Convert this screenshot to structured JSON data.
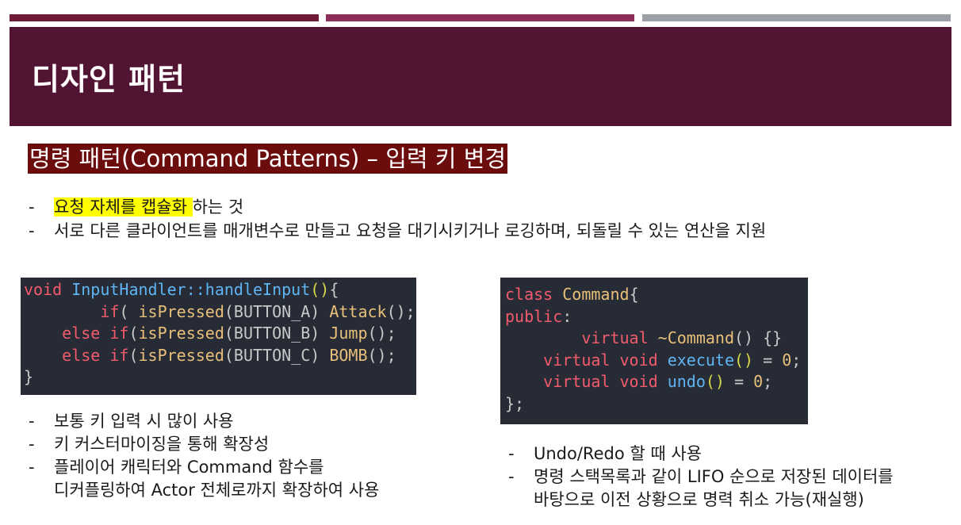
{
  "colors": {
    "topbar": [
      "#6f1a36",
      "#8c2d5a",
      "#9aa0a6"
    ],
    "header_bg": "#521433",
    "subtitle_bg": "#6b0d0d",
    "highlight": "#ffff00",
    "code_bg": "#272b35",
    "code_keyword": "#f35b6d",
    "code_function": "#5fb5f3",
    "code_type": "#e8c07a",
    "code_paren": "#d8d84a",
    "code_text": "#c8c8c8"
  },
  "header": {
    "title": "디자인 패턴"
  },
  "subtitle": "명령 패턴(Command Patterns) – 입력 키 변경",
  "intro_bullets": [
    {
      "dash": "-",
      "highlight": "요청 자체를 캡슐화 ",
      "text": "하는 것"
    },
    {
      "dash": "-",
      "highlight": "",
      "text": "서로 다른 클라이언트를 매개변수로 만들고 요청을 대기시키거나 로깅하며, 되돌릴 수 있는 연산을 지원"
    }
  ],
  "code_left": {
    "icon": "code-snippet",
    "lines": [
      [
        [
          "kw",
          "void"
        ],
        [
          "tx",
          " "
        ],
        [
          "fn",
          "InputHandler::handleInput"
        ],
        [
          "pr",
          "()"
        ],
        [
          "tx",
          "{"
        ]
      ],
      [
        [
          "tx",
          "        "
        ],
        [
          "kw",
          "if"
        ],
        [
          "tx",
          "( "
        ],
        [
          "ty",
          "isPressed"
        ],
        [
          "tx",
          "(BUTTON_A) "
        ],
        [
          "ty",
          "Attack"
        ],
        [
          "tx",
          "();"
        ]
      ],
      [
        [
          "tx",
          "    "
        ],
        [
          "kw",
          "else if"
        ],
        [
          "tx",
          "("
        ],
        [
          "ty",
          "isPressed"
        ],
        [
          "tx",
          "(BUTTON_B) "
        ],
        [
          "ty",
          "Jump"
        ],
        [
          "tx",
          "();"
        ]
      ],
      [
        [
          "tx",
          "    "
        ],
        [
          "kw",
          "else if"
        ],
        [
          "tx",
          "("
        ],
        [
          "ty",
          "isPressed"
        ],
        [
          "tx",
          "(BUTTON_C) "
        ],
        [
          "ty",
          "BOMB"
        ],
        [
          "tx",
          "();"
        ]
      ],
      [
        [
          "tx",
          "}"
        ]
      ]
    ]
  },
  "code_right": {
    "icon": "code-snippet",
    "lines": [
      [
        [
          "kw",
          "class"
        ],
        [
          "tx",
          " "
        ],
        [
          "ty",
          "Command"
        ],
        [
          "tx",
          "{"
        ]
      ],
      [
        [
          "kw",
          "public"
        ],
        [
          "tx",
          ":"
        ]
      ],
      [
        [
          "tx",
          "        "
        ],
        [
          "kw",
          "virtual"
        ],
        [
          "tx",
          " "
        ],
        [
          "ty",
          "~Command"
        ],
        [
          "tx",
          "() {}"
        ]
      ],
      [
        [
          "tx",
          "    "
        ],
        [
          "kw",
          "virtual void"
        ],
        [
          "tx",
          " "
        ],
        [
          "fn",
          "execute"
        ],
        [
          "pr",
          "()"
        ],
        [
          "tx",
          " = "
        ],
        [
          "ty",
          "0"
        ],
        [
          "tx",
          ";"
        ]
      ],
      [
        [
          "tx",
          "    "
        ],
        [
          "kw",
          "virtual void"
        ],
        [
          "tx",
          " "
        ],
        [
          "fn",
          "undo"
        ],
        [
          "pr",
          "()"
        ],
        [
          "tx",
          " = "
        ],
        [
          "ty",
          "0"
        ],
        [
          "tx",
          ";"
        ]
      ],
      [
        [
          "tx",
          "};"
        ]
      ]
    ]
  },
  "left_bullets": [
    {
      "dash": "-",
      "text": "보통 키 입력 시 많이 사용"
    },
    {
      "dash": "-",
      "text": "키 커스터마이징을 통해 확장성"
    },
    {
      "dash": "-",
      "text": "플레이어 캐릭터와 Command 함수를"
    },
    {
      "dash": "",
      "text": "디커플링하여 Actor 전체로까지 확장하여 사용"
    }
  ],
  "right_bullets": [
    {
      "dash": "-",
      "text": "Undo/Redo 할 때 사용"
    },
    {
      "dash": "-",
      "text": "명령 스택목록과 같이 LIFO 순으로 저장된 데이터를"
    },
    {
      "dash": "",
      "text": "바탕으로 이전 상황으로 명력 취소 가능(재실행)"
    }
  ]
}
